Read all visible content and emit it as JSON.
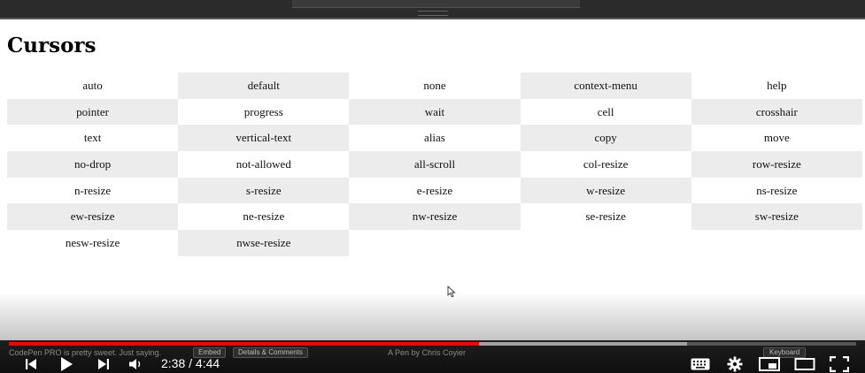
{
  "page": {
    "title": "Cursors"
  },
  "cursor_cells": [
    "auto",
    "default",
    "none",
    "context-menu",
    "help",
    "pointer",
    "progress",
    "wait",
    "cell",
    "crosshair",
    "text",
    "vertical-text",
    "alias",
    "copy",
    "move",
    "no-drop",
    "not-allowed",
    "all-scroll",
    "col-resize",
    "row-resize",
    "n-resize",
    "s-resize",
    "e-resize",
    "w-resize",
    "ns-resize",
    "ew-resize",
    "ne-resize",
    "nw-resize",
    "se-resize",
    "sw-resize",
    "nesw-resize",
    "nwse-resize"
  ],
  "codepen_bar": {
    "tagline": "CodePen PRO is pretty sweet. Just saying.",
    "embed_label": "Embed",
    "details_label": "Details & Comments",
    "byline": "A Pen by Chris Coyier",
    "keyboard_label": "Keyboard"
  },
  "player": {
    "time_display": "2:38 / 4:44",
    "progress_fraction": 0.555,
    "buffer_fraction": 0.8,
    "accent_color": "#ff0000",
    "icons": [
      "skip-previous-icon",
      "play-icon",
      "skip-next-icon",
      "volume-icon",
      "keyboard-icon",
      "settings-icon",
      "miniplayer-icon",
      "theater-icon",
      "fullscreen-icon"
    ]
  }
}
